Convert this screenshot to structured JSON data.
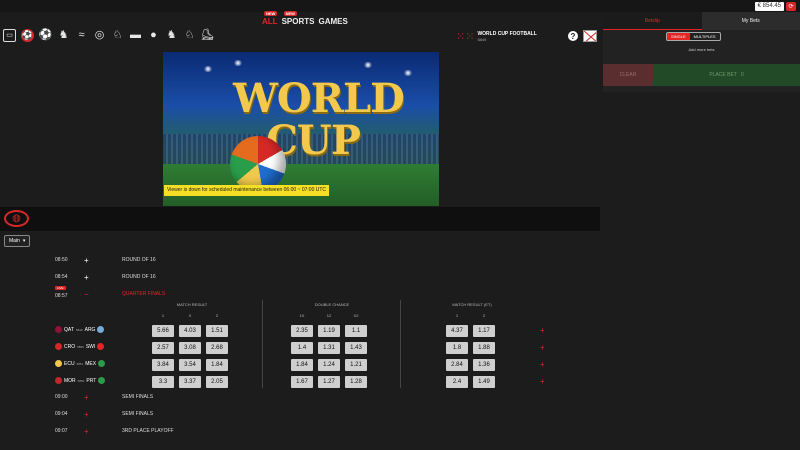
{
  "header": {
    "balance": "€ 854.45",
    "balance_icon": "refresh-icon",
    "nav": [
      {
        "label": "ALL",
        "badge": "NEW",
        "active": true
      },
      {
        "label": "SPORTS",
        "badge": "NEW",
        "active": false
      },
      {
        "label": "GAMES",
        "badge": "",
        "active": false
      }
    ]
  },
  "sports_icons": [
    "tv-icon",
    "soccer-icon",
    "football-icon",
    "horse-racing-icon",
    "greyhound-icon",
    "target-icon",
    "jumping-icon",
    "motor-racing-icon",
    "table-tennis-icon",
    "trotting-icon",
    "harness-racing-icon",
    "ice-hockey-icon"
  ],
  "event": {
    "title": "WORLD CUP FOOTBALL",
    "subtitle": "5849"
  },
  "banner": {
    "title_line1": "WORLD",
    "title_line2": "CUP",
    "maintenance_notice": "Viewer is down for scheduled maintenance between 06:00 ~ 07:00 UTC"
  },
  "market_select": {
    "value": "Main"
  },
  "rounds": [
    {
      "time": "08:50",
      "expander": "+",
      "label": "ROUND OF 16",
      "highlight": false
    },
    {
      "time": "08:54",
      "expander": "+",
      "label": "ROUND OF 16",
      "highlight": false
    },
    {
      "time": "08:57",
      "expander": "−",
      "label": "QUARTER FINALS",
      "highlight": true,
      "badge": "LIVE"
    }
  ],
  "markets": {
    "match_result": {
      "title": "MATCH RESULT",
      "cols": [
        "1",
        "X",
        "2"
      ]
    },
    "double_chance": {
      "title": "DOUBLE CHANCE",
      "cols": [
        "1X",
        "12",
        "X2"
      ]
    },
    "match_result_et": {
      "title": "MATCH RESULT (ET)",
      "cols": [
        "1",
        "2"
      ]
    }
  },
  "matches": [
    {
      "home": "QAT",
      "away": "ARG",
      "id": "5849",
      "home_color": "#8a1538",
      "away_color": "#75aadb",
      "mr": [
        "5.66",
        "4.03",
        "1.51"
      ],
      "dc": [
        "2.35",
        "1.19",
        "1.1"
      ],
      "et": [
        "4.37",
        "1.17"
      ]
    },
    {
      "home": "CRO",
      "away": "SWI",
      "id": "5850",
      "home_color": "#d62828",
      "away_color": "#e52525",
      "mr": [
        "2.57",
        "3.08",
        "2.68"
      ],
      "dc": [
        "1.4",
        "1.31",
        "1.43"
      ],
      "et": [
        "1.8",
        "1.88"
      ]
    },
    {
      "home": "ECU",
      "away": "MEX",
      "id": "5851",
      "home_color": "#f2c94c",
      "away_color": "#2a9d4a",
      "mr": [
        "3.84",
        "3.54",
        "1.84"
      ],
      "dc": [
        "1.84",
        "1.24",
        "1.21"
      ],
      "et": [
        "2.84",
        "1.36"
      ]
    },
    {
      "home": "MOR",
      "away": "PRT",
      "id": "5852",
      "home_color": "#c1272d",
      "away_color": "#2a9d4a",
      "mr": [
        "3.3",
        "3.37",
        "2.05"
      ],
      "dc": [
        "1.67",
        "1.27",
        "1.28"
      ],
      "et": [
        "2.4",
        "1.49"
      ]
    }
  ],
  "later_rounds": [
    {
      "time": "09:00",
      "expander": "+",
      "label": "SEMI FINALS"
    },
    {
      "time": "09:04",
      "expander": "+",
      "label": "SEMI FINALS"
    },
    {
      "time": "09:07",
      "expander": "+",
      "label": "3RD PLACE PLAYOFF"
    }
  ],
  "betslip": {
    "tab_betslip": "Betslip",
    "tab_mybets": "My Bets",
    "mode_single": "SINGLE",
    "mode_multiples": "MULTIPLES",
    "empty_text": "Add more bets",
    "clear_label": "CLEAR",
    "place_label": "PLACE BET",
    "place_amount": "0"
  },
  "colors": {
    "accent": "#e52525",
    "notice": "#f5df25",
    "odd_bg": "#cfcfcf"
  }
}
